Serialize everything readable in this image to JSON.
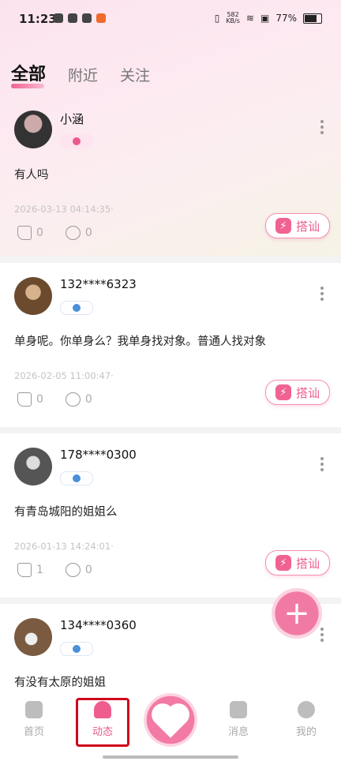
{
  "status_bar": {
    "time": "11:23",
    "net_speed": "582",
    "net_unit": "KB/s",
    "battery": "77%"
  },
  "tabs": [
    {
      "label": "全部",
      "active": true
    },
    {
      "label": "附近",
      "active": false
    },
    {
      "label": "关注",
      "active": false
    }
  ],
  "posts": [
    {
      "name": "小涵",
      "gender": "female",
      "content": "有人吗",
      "time": "2026-03-13 04:14:35·",
      "likes": "0",
      "comments": "0",
      "action_label": "搭讪"
    },
    {
      "name": "132****6323",
      "gender": "male",
      "content": "单身呢。你单身么？我单身找对象。普通人找对象",
      "time": "2026-02-05 11:00:47·",
      "likes": "0",
      "comments": "0",
      "action_label": "搭讪"
    },
    {
      "name": "178****0300",
      "gender": "male",
      "content": "有青岛城阳的姐姐么",
      "time": "2026-01-13 14:24:01·",
      "likes": "1",
      "comments": "0",
      "action_label": "搭讪"
    },
    {
      "name": "134****0360",
      "gender": "male",
      "content": "有没有太原的姐姐"
    }
  ],
  "fab": {
    "symbol": "+"
  },
  "nav": {
    "home": "首页",
    "feed": "动态",
    "messages": "消息",
    "mine": "我的"
  },
  "colors": {
    "accent": "#ec5b8e",
    "highlight": "#d0021b"
  }
}
